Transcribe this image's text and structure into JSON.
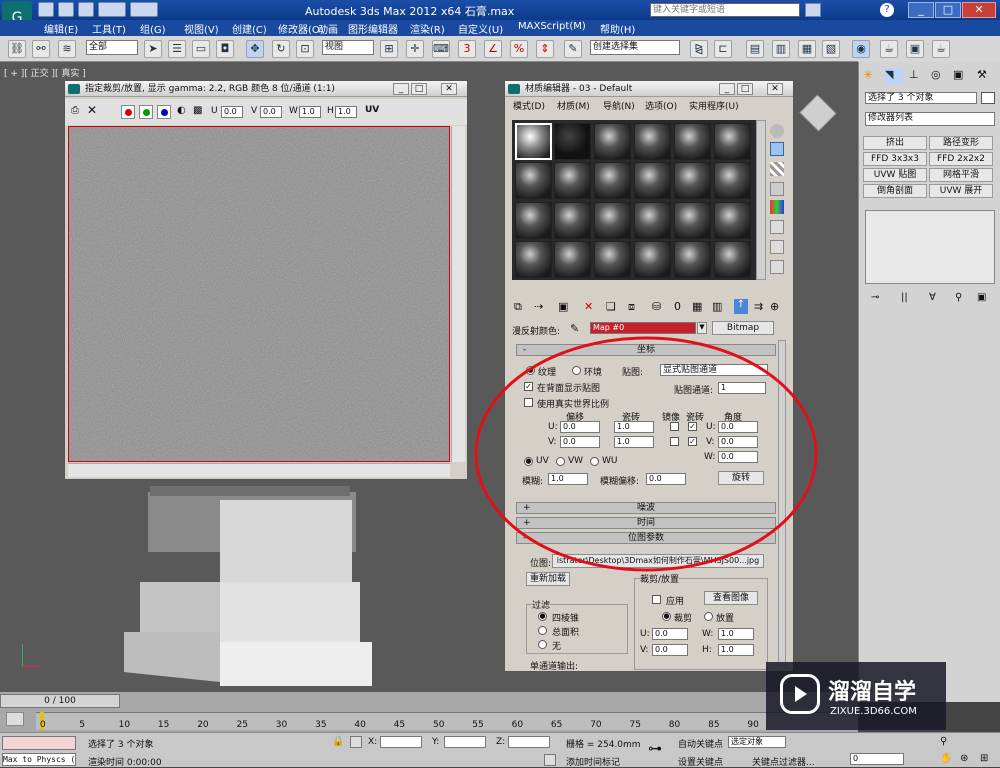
{
  "app": {
    "title": "Autodesk 3ds Max  2012 x64     石膏.max",
    "search_placeholder": "键入关键字或短语"
  },
  "menu": [
    "编辑(E)",
    "工具(T)",
    "组(G)",
    "视图(V)",
    "创建(C)",
    "修改器(O)",
    "动画",
    "图形编辑器",
    "渲染(R)",
    "自定义(U)",
    "MAXScript(M)",
    "帮助(H)"
  ],
  "toolbar": {
    "selection_filter": "全部",
    "ref_coord": "视图",
    "named_selection": "创建选择集"
  },
  "viewport": {
    "label": "[ + ][ 正交 ][ 真实 ]"
  },
  "texture_window": {
    "title": "指定裁剪/放置, 显示 gamma: 2.2, RGB 颜色 8 位/通道 (1:1)",
    "u_label": "U",
    "u_val": "0.0",
    "v_label": "V",
    "v_val": "0.0",
    "w_label": "W",
    "w_val": "1.0",
    "h_label": "H",
    "h_val": "1.0",
    "uv_label": "UV"
  },
  "mat_editor": {
    "title": "材质编辑器 - 03 - Default",
    "menus": [
      "模式(D)",
      "材质(M)",
      "导航(N)",
      "选项(O)",
      "实用程序(U)"
    ],
    "diffuse_label": "漫反射颜色:",
    "map_name": "Map #0",
    "map_type": "Bitmap",
    "coords": {
      "header": "坐标",
      "texture": "纹理",
      "environ": "环境",
      "mapping_label": "贴图:",
      "mapping_val": "显式贴图通道",
      "show_back": "在背面显示贴图",
      "map_channel_label": "贴图通道:",
      "map_channel_val": "1",
      "real_world": "使用真实世界比例",
      "offset": "偏移",
      "tiling": "瓷砖",
      "mirror": "镜像",
      "tile": "瓷砖",
      "angle": "角度",
      "u": "U:",
      "v": "V:",
      "w": "W:",
      "u_off": "0.0",
      "v_off": "0.0",
      "u_tile": "1.0",
      "v_tile": "1.0",
      "u_ang": "0.0",
      "v_ang": "0.0",
      "w_ang": "0.0",
      "uv": "UV",
      "vw": "VW",
      "wu": "WU",
      "blur_label": "模糊:",
      "blur_val": "1.0",
      "blur_off_label": "模糊偏移:",
      "blur_off_val": "0.0",
      "rotate": "旋转"
    },
    "noise": "噪波",
    "time": "时间",
    "bitmap": {
      "header": "位图参数",
      "path_label": "位图:",
      "path": "istrator\\Desktop\\3Dmax如何制作石膏\\MHSJS00...jpg",
      "reload": "重新加载",
      "crop_group": "裁剪/放置",
      "apply": "应用",
      "view_image": "查看图像",
      "crop": "裁剪",
      "place": "放置",
      "filter": "过滤",
      "pyramidal": "四棱锥",
      "summed": "总面积",
      "none": "无",
      "u": "U:",
      "v": "V:",
      "w": "W:",
      "h": "H:",
      "u_val": "0.0",
      "v_val": "0.0",
      "w_val": "1.0",
      "h_val": "1.0",
      "mono": "单通道输出:"
    }
  },
  "cmd": {
    "selected": "选择了 3 个对象",
    "modlist": "修改器列表",
    "buttons": [
      "挤出",
      "路径变形",
      "FFD 3x3x3",
      "FFD 2x2x2",
      "UVW 贴图",
      "网格平滑",
      "倒角剖面",
      "UVW 展开"
    ]
  },
  "timeline": {
    "frame": "0 / 100",
    "ticks": [
      "0",
      "5",
      "10",
      "15",
      "20",
      "25",
      "30",
      "35",
      "40",
      "45",
      "50",
      "55",
      "60",
      "65",
      "70",
      "75",
      "80",
      "85",
      "90"
    ]
  },
  "status": {
    "script": "Max to Physcs (",
    "selected": "选择了 3 个对象",
    "render_time": "渲染时间  0:00:00",
    "x": "X:",
    "y": "Y:",
    "z": "Z:",
    "grid": "栅格 = 254.0mm",
    "add_tag": "添加时间标记",
    "auto_key": "自动关键点",
    "set_key": "设置关键点",
    "selected_obj": "选定对象",
    "key_filter": "关键点过滤器...",
    "frame_val": "0"
  },
  "watermark": {
    "brand": "溜溜自学",
    "url": "ZIXUE.3D66.COM"
  },
  "colors": {
    "title_bar": "#1d4fa8",
    "viewport": "#595959",
    "panel": "#d4d0c8",
    "accent_red": "#d40000"
  }
}
